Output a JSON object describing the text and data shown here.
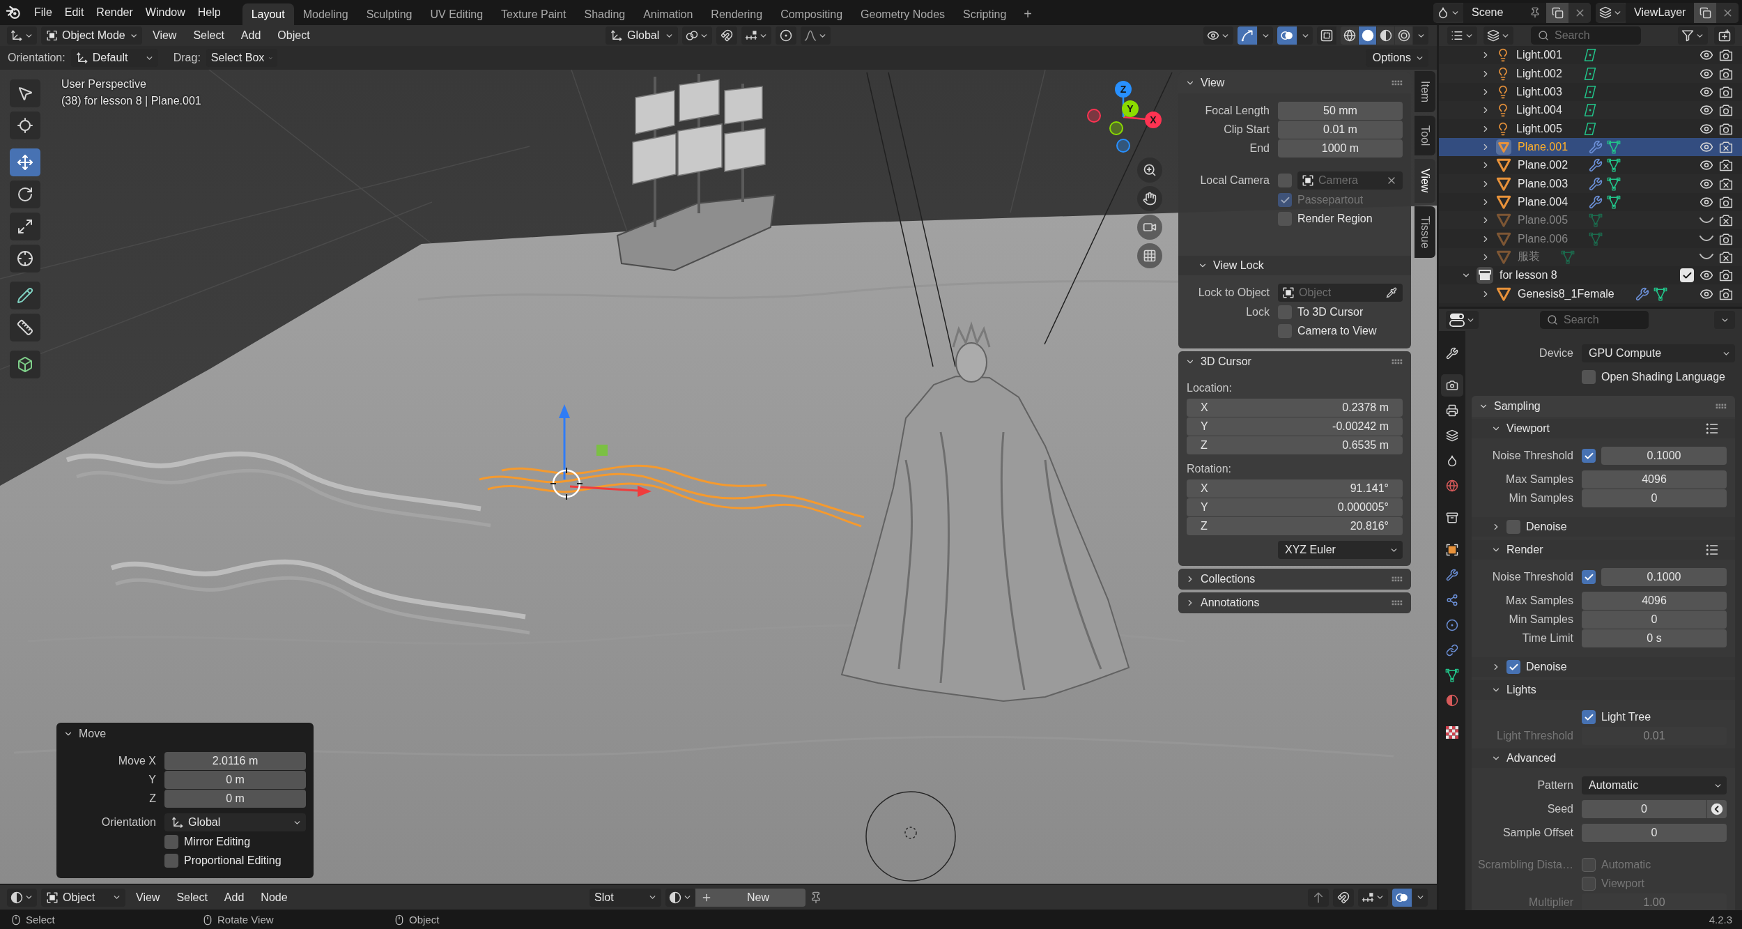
{
  "top_bar": {
    "menus": [
      "File",
      "Edit",
      "Render",
      "Window",
      "Help"
    ],
    "workspaces": [
      {
        "label": "Layout",
        "selected": true
      },
      {
        "label": "Modeling",
        "selected": false
      },
      {
        "label": "Sculpting",
        "selected": false
      },
      {
        "label": "UV Editing",
        "selected": false
      },
      {
        "label": "Texture Paint",
        "selected": false
      },
      {
        "label": "Shading",
        "selected": false
      },
      {
        "label": "Animation",
        "selected": false
      },
      {
        "label": "Rendering",
        "selected": false
      },
      {
        "label": "Compositing",
        "selected": false
      },
      {
        "label": "Geometry Nodes",
        "selected": false
      },
      {
        "label": "Scripting",
        "selected": false
      }
    ],
    "add_workspace": "+",
    "scene": "Scene",
    "view_layer": "ViewLayer"
  },
  "viewport": {
    "header": {
      "mode": "Object Mode",
      "menus": [
        "View",
        "Select",
        "Add",
        "Object"
      ],
      "transform_orientation": "Global",
      "toggles": [
        {
          "kind": "gizmos",
          "on": true
        },
        {
          "kind": "overlays",
          "on": true
        },
        {
          "kind": "xray",
          "on": false
        }
      ],
      "shading": [
        {
          "kind": "wireframe",
          "selected": false
        },
        {
          "kind": "solid",
          "selected": true
        },
        {
          "kind": "material",
          "selected": false
        },
        {
          "kind": "rendered",
          "selected": false
        }
      ]
    },
    "tool_settings": {
      "orientation_label": "Orientation:",
      "orientation": "Default",
      "drag_label": "Drag:",
      "drag": "Select Box",
      "options": "Options"
    },
    "info": [
      "User Perspective",
      "(38) for lesson 8 | Plane.001"
    ],
    "tools": [
      {
        "kind": "select_box",
        "selected": false
      },
      {
        "kind": "cursor",
        "selected": false
      },
      {
        "kind": "move",
        "selected": true
      },
      {
        "kind": "rotate",
        "selected": false
      },
      {
        "kind": "scale",
        "selected": false
      },
      {
        "kind": "transform",
        "selected": false
      },
      {
        "kind": "annotate",
        "selected": false
      },
      {
        "kind": "measure",
        "selected": false
      },
      {
        "kind": "add_cube",
        "selected": false
      }
    ],
    "navigation_axes": [
      {
        "label": "X",
        "color": "#ff3352"
      },
      {
        "label": "Y",
        "color": "#8bdc00"
      },
      {
        "label": "Z",
        "color": "#2890ff"
      }
    ],
    "sidebar": {
      "tabs": [
        {
          "label": "Item",
          "selected": false
        },
        {
          "label": "Tool",
          "selected": false
        },
        {
          "label": "View",
          "selected": true
        },
        {
          "label": "Tissue",
          "selected": false
        }
      ],
      "panels": [
        {
          "title": "View",
          "expanded": true,
          "rows": [
            {
              "kind": "number",
              "label": "Focal Length",
              "value": "50 mm",
              "disabled": false
            },
            {
              "kind": "number",
              "label": "Clip Start",
              "value": "0.01 m",
              "disabled": false
            },
            {
              "kind": "number",
              "label": "End",
              "value": "1000 m",
              "disabled": false
            },
            {
              "kind": "camera_pick",
              "label": "Local Camera",
              "checked": false,
              "placeholder": "Camera",
              "disabled": false
            },
            {
              "kind": "check",
              "text": "Passepartout",
              "checked": true,
              "disabled": true
            },
            {
              "kind": "check",
              "text": "Render Region",
              "checked": false,
              "disabled": false
            },
            {
              "kind": "sub",
              "title": "View Lock",
              "expanded": true,
              "disabled": false,
              "rows": [
                {
                  "kind": "object_pick",
                  "label": "Lock to Object",
                  "placeholder": "Object"
                },
                {
                  "kind": "check",
                  "label": "Lock",
                  "text": "To 3D Cursor",
                  "checked": false
                },
                {
                  "kind": "check",
                  "text": "Camera to View",
                  "checked": false
                }
              ]
            }
          ]
        },
        {
          "title": "3D Cursor",
          "expanded": true,
          "rows": [
            {
              "kind": "heading",
              "text": "Location:"
            },
            {
              "kind": "axis",
              "axis": "X",
              "value": "0.2378 m"
            },
            {
              "kind": "axis",
              "axis": "Y",
              "value": "-0.00242 m"
            },
            {
              "kind": "axis",
              "axis": "Z",
              "value": "0.6535 m"
            },
            {
              "kind": "heading",
              "text": "Rotation:"
            },
            {
              "kind": "axis",
              "axis": "X",
              "value": "91.141°"
            },
            {
              "kind": "axis",
              "axis": "Y",
              "value": "0.000005°"
            },
            {
              "kind": "axis",
              "axis": "Z",
              "value": "20.816°"
            },
            {
              "kind": "dropdown",
              "value": "XYZ Euler"
            }
          ]
        },
        {
          "title": "Collections",
          "expanded": false
        },
        {
          "title": "Annotations",
          "expanded": false
        }
      ]
    },
    "last_operation": {
      "title": "Move",
      "expanded": true,
      "rows": [
        {
          "kind": "number",
          "label": "Move X",
          "value": "2.0116 m"
        },
        {
          "kind": "number",
          "label": "Y",
          "value": "0 m"
        },
        {
          "kind": "number",
          "label": "Z",
          "value": "0 m"
        },
        {
          "kind": "orientation_dropdown",
          "label": "Orientation",
          "value": "Global"
        },
        {
          "kind": "check",
          "text": "Mirror Editing",
          "checked": false
        },
        {
          "kind": "check",
          "text": "Proportional Editing",
          "checked": false
        }
      ]
    }
  },
  "outliner": {
    "search_placeholder": "Search",
    "items": [
      {
        "name": "Light.001",
        "kind": "light",
        "expanded": false,
        "selected": false,
        "visible": true,
        "renderable": true,
        "modifiers": false
      },
      {
        "name": "Light.002",
        "kind": "light",
        "expanded": false,
        "selected": false,
        "visible": true,
        "renderable": true,
        "modifiers": false
      },
      {
        "name": "Light.003",
        "kind": "light",
        "expanded": false,
        "selected": false,
        "visible": true,
        "renderable": true,
        "modifiers": false
      },
      {
        "name": "Light.004",
        "kind": "light",
        "expanded": false,
        "selected": false,
        "visible": true,
        "renderable": true,
        "modifiers": false
      },
      {
        "name": "Light.005",
        "kind": "light",
        "expanded": false,
        "selected": false,
        "visible": true,
        "renderable": true,
        "modifiers": false
      },
      {
        "name": "Plane.001",
        "kind": "mesh",
        "expanded": false,
        "selected": true,
        "visible": true,
        "renderable": false,
        "modifiers": true
      },
      {
        "name": "Plane.002",
        "kind": "mesh",
        "expanded": false,
        "selected": false,
        "visible": true,
        "renderable": false,
        "modifiers": true
      },
      {
        "name": "Plane.003",
        "kind": "mesh",
        "expanded": false,
        "selected": false,
        "visible": true,
        "renderable": false,
        "modifiers": true
      },
      {
        "name": "Plane.004",
        "kind": "mesh",
        "expanded": false,
        "selected": false,
        "visible": true,
        "renderable": true,
        "modifiers": true
      },
      {
        "name": "Plane.005",
        "kind": "mesh",
        "expanded": false,
        "selected": false,
        "visible": false,
        "renderable": false,
        "modifiers": false
      },
      {
        "name": "Plane.006",
        "kind": "mesh",
        "expanded": false,
        "selected": false,
        "visible": false,
        "renderable": true,
        "modifiers": false
      },
      {
        "name": "服装",
        "kind": "mesh",
        "expanded": false,
        "selected": false,
        "visible": false,
        "renderable": false,
        "modifiers": false
      },
      {
        "name": "for lesson 8",
        "kind": "collection",
        "expanded": true,
        "selected": false,
        "visible": true,
        "renderable": true,
        "modifiers": false,
        "included": true,
        "children": [
          {
            "name": "Genesis8_1Female",
            "kind": "mesh",
            "expanded": false,
            "selected": false,
            "visible": true,
            "renderable": true,
            "modifiers": true
          }
        ]
      }
    ]
  },
  "properties": {
    "search_placeholder": "Search",
    "tabs": [
      {
        "kind": "tool",
        "selected": false
      },
      {
        "kind": "render",
        "selected": true
      },
      {
        "kind": "output",
        "selected": false
      },
      {
        "kind": "view_layer",
        "selected": false
      },
      {
        "kind": "scene",
        "selected": false
      },
      {
        "kind": "world",
        "selected": false
      },
      {
        "kind": "collection",
        "selected": false
      },
      {
        "kind": "object",
        "selected": false
      },
      {
        "kind": "modifiers",
        "selected": false
      },
      {
        "kind": "particles",
        "selected": false
      },
      {
        "kind": "physics",
        "selected": false
      },
      {
        "kind": "constraints",
        "selected": false
      },
      {
        "kind": "data",
        "selected": false
      },
      {
        "kind": "material",
        "selected": false
      },
      {
        "kind": "texture",
        "selected": false
      }
    ],
    "rows": [
      {
        "kind": "dropdown",
        "label": "Device",
        "value": "GPU Compute"
      },
      {
        "kind": "check",
        "text": "Open Shading Language",
        "checked": false
      },
      {
        "kind": "panel",
        "title": "Sampling",
        "expanded": true,
        "rows": [
          {
            "kind": "sub",
            "title": "Viewport",
            "expanded": true,
            "presets": true,
            "rows": [
              {
                "kind": "check_number",
                "label": "Noise Threshold",
                "checked": true,
                "value": "0.1000"
              },
              {
                "kind": "number",
                "label": "Max Samples",
                "value": "4096"
              },
              {
                "kind": "number",
                "label": "Min Samples",
                "value": "0"
              },
              {
                "kind": "sub",
                "title": "Denoise",
                "expanded": false,
                "checked": false
              }
            ]
          },
          {
            "kind": "sub",
            "title": "Render",
            "expanded": true,
            "presets": true,
            "rows": [
              {
                "kind": "check_number",
                "label": "Noise Threshold",
                "checked": true,
                "value": "0.1000"
              },
              {
                "kind": "number",
                "label": "Max Samples",
                "value": "4096"
              },
              {
                "kind": "number",
                "label": "Min Samples",
                "value": "0"
              },
              {
                "kind": "number",
                "label": "Time Limit",
                "value": "0 s"
              },
              {
                "kind": "sub",
                "title": "Denoise",
                "expanded": false,
                "checked": true
              }
            ]
          },
          {
            "kind": "sub",
            "title": "Lights",
            "expanded": true,
            "presets": false,
            "rows": [
              {
                "kind": "check",
                "text": "Light Tree",
                "checked": true,
                "disabled": false
              },
              {
                "kind": "number",
                "label": "Light Threshold",
                "value": "0.01",
                "disabled": true
              }
            ]
          },
          {
            "kind": "sub",
            "title": "Advanced",
            "expanded": true,
            "presets": false,
            "rows": [
              {
                "kind": "dropdown",
                "label": "Pattern",
                "value": "Automatic",
                "disabled": false
              },
              {
                "kind": "seed",
                "label": "Seed",
                "value": "0",
                "disabled": false
              },
              {
                "kind": "number",
                "label": "Sample Offset",
                "value": "0",
                "disabled": false
              },
              {
                "kind": "check",
                "label": "Scrambling Dista…",
                "text": "Automatic",
                "checked": false,
                "disabled": true
              },
              {
                "kind": "check",
                "text": "Viewport",
                "checked": false,
                "disabled": true
              },
              {
                "kind": "number",
                "label": "Multiplier",
                "value": "1.00",
                "disabled": true
              }
            ]
          }
        ]
      }
    ]
  },
  "node_editor": {
    "data_type": "Object",
    "menus": [
      "View",
      "Select",
      "Add",
      "Node"
    ],
    "slot": "Slot",
    "new_button": "New",
    "overlays": true
  },
  "status_bar": {
    "hints": [
      "Select",
      "Rotate View",
      "Object"
    ],
    "version": "4.2.3"
  }
}
